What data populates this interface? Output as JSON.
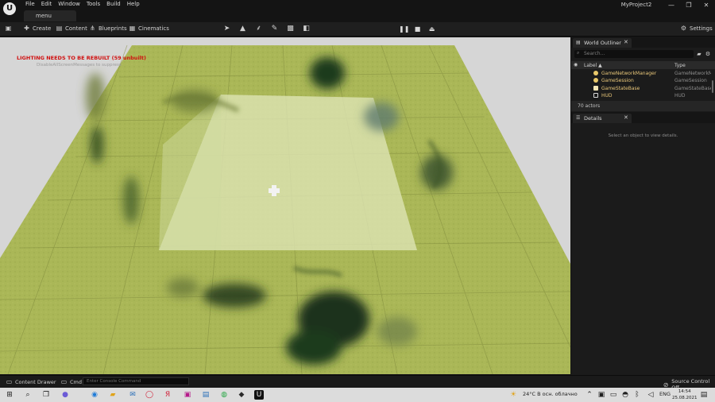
{
  "window": {
    "menus": [
      "File",
      "Edit",
      "Window",
      "Tools",
      "Build",
      "Help"
    ],
    "level_tab": "menu",
    "project_name": "MyProject2",
    "controls": [
      "—",
      "❐",
      "✕"
    ]
  },
  "toolbar": {
    "save_icon": "save-icon",
    "create_label": "Create",
    "content_label": "Content",
    "blueprints_label": "Blueprints",
    "cinematics_label": "Cinematics",
    "settings_label": "Settings"
  },
  "viewport": {
    "lighting_warning": "LIGHTING NEEDS TO BE REBUILT (59 unbuilt)",
    "screen_message": "DisableAllScreenMessages to suppress",
    "ground_color": "#a9b556",
    "sky_color": "#d6d6d6"
  },
  "outliner": {
    "tab_label": "World Outliner",
    "search_placeholder": "Search...",
    "col_label": "Label ▲",
    "col_type": "Type",
    "rows": [
      {
        "label": "GameNetworkManager",
        "type": "GameNetworkM"
      },
      {
        "label": "GameSession",
        "type": "GameSession"
      },
      {
        "label": "GameStateBase",
        "type": "GameStateBase"
      },
      {
        "label": "HUD",
        "type": "HUD"
      }
    ],
    "actor_count": "70 actors"
  },
  "details": {
    "tab_label": "Details",
    "empty_message": "Select an object to view details."
  },
  "statusbar": {
    "content_drawer": "Content Drawer",
    "cmd_label": "Cmd",
    "console_placeholder": "Enter Console Command",
    "source_control": "Source Control Off"
  },
  "taskbar": {
    "weather": "24°C  В осн. облачно",
    "language": "ENG",
    "time": "14:54",
    "date": "25.08.2021"
  }
}
